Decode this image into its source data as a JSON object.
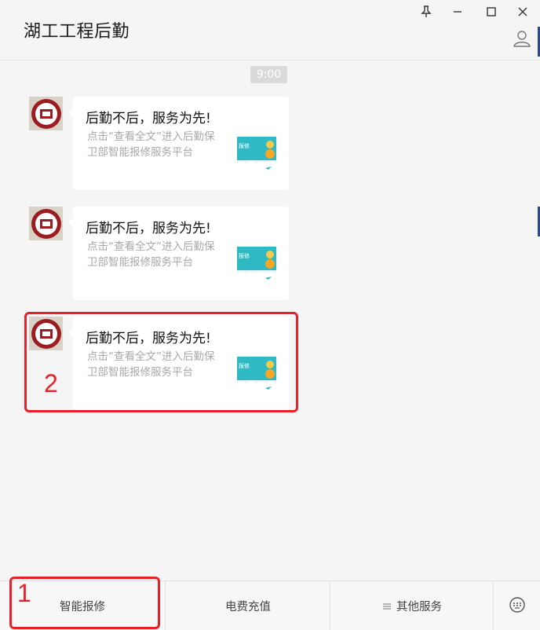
{
  "window": {
    "title": "湖工工程后勤"
  },
  "chat": {
    "timestamp": "9:00",
    "messages": [
      {
        "title": "后勤不后，服务为先!",
        "description": "点击“查看全文”进入后勤保卫部智能报修服务平台",
        "thumbnail_text": "报修"
      },
      {
        "title": "后勤不后，服务为先!",
        "description": "点击“查看全文”进入后勤保卫部智能报修服务平台",
        "thumbnail_text": "报修"
      },
      {
        "title": "后勤不后，服务为先!",
        "description": "点击“查看全文”进入后勤保卫部智能报修服务平台",
        "thumbnail_text": "报修"
      }
    ]
  },
  "annotations": {
    "label_1": "1",
    "label_2": "2"
  },
  "menu": {
    "item1": "智能报修",
    "item2": "电费充值",
    "item3": "其他服务"
  },
  "colors": {
    "highlight": "#e8202a",
    "thumbnail_teal": "#2fb9c4",
    "avatar_red": "#9b1d22"
  }
}
